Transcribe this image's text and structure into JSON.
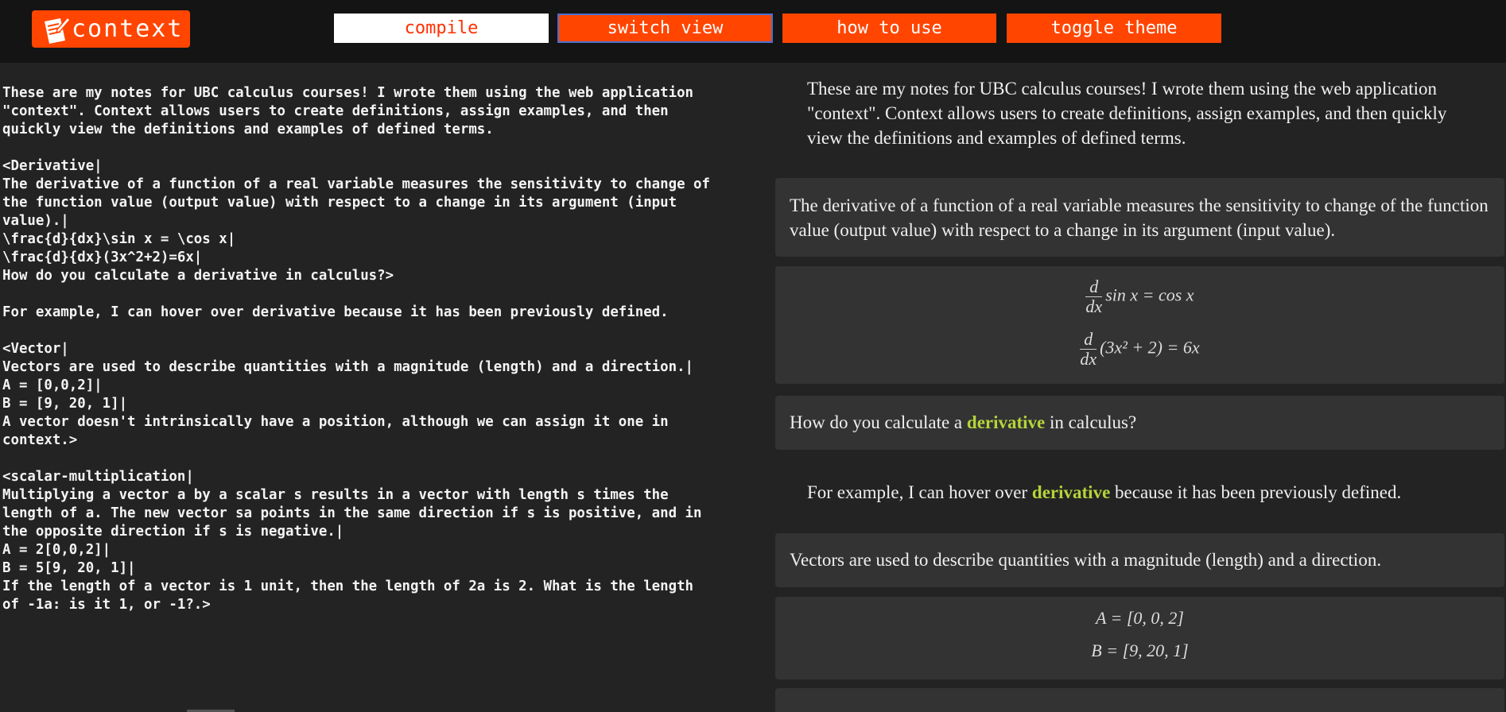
{
  "header": {
    "logo_text": "context",
    "logo_icon": "pencil-paper-icon",
    "buttons": {
      "compile": "compile",
      "switch_view": "switch view",
      "how_to_use": "how to use",
      "toggle_theme": "toggle theme"
    }
  },
  "editor": {
    "source": "These are my notes for UBC calculus courses! I wrote them using the web application\n\"context\". Context allows users to create definitions, assign examples, and then\nquickly view the definitions and examples of defined terms.\n\n<Derivative|\nThe derivative of a function of a real variable measures the sensitivity to change of\nthe function value (output value) with respect to a change in its argument (input\nvalue).|\n\\frac{d}{dx}\\sin x = \\cos x|\n\\frac{d}{dx}(3x^2+2)=6x|\nHow do you calculate a derivative in calculus?>\n\nFor example, I can hover over derivative because it has been previously defined.\n\n<Vector|\nVectors are used to describe quantities with a magnitude (length) and a direction.|\nA = [0,0,2]|\nB = [9, 20, 1]|\nA vector doesn't intrinsically have a position, although we can assign it one in\ncontext.>\n\n<scalar-multiplication|\nMultiplying a vector a by a scalar s results in a vector with length s times the\nlength of a. The new vector sa points in the same direction if s is positive, and in\nthe opposite direction if s is negative.|\nA = 2[0,0,2]|\nB = 5[9, 20, 1]|\nIf the length of a vector is 1 unit, then the length of 2a is 2. What is the length\nof -1a: is it 1, or -1?.>"
  },
  "preview": {
    "intro": "These are my notes for UBC calculus courses! I wrote them using the web application \"context\". Context allows users to create definitions, assign examples, and then quickly view the definitions and examples of defined terms.",
    "derivative_definition": "The derivative of a function of a real variable measures the sensitivity to change of the function value (output value) with respect to a change in its argument (input value).",
    "derivative_examples": {
      "frac_num": "d",
      "frac_den": "dx",
      "ex1_rhs": "sin x = cos x",
      "ex2_rhs": "(3x² + 2) = 6x"
    },
    "derivative_question": {
      "before": "How do you calculate a ",
      "term": "derivative",
      "after": " in calculus?"
    },
    "example_line": {
      "before": "For example, I can hover over ",
      "term": "derivative",
      "after": " because it has been previously defined."
    },
    "vector_definition": "Vectors are used to describe quantities with a magnitude (length) and a direction.",
    "vector_examples": {
      "a": "A = [0, 0, 2]",
      "b": "B = [9, 20, 1]"
    }
  },
  "colors": {
    "accent": "#ff4500",
    "highlight": "#b5d33a",
    "background": "#232323",
    "header": "#141414",
    "card": "#333333"
  }
}
